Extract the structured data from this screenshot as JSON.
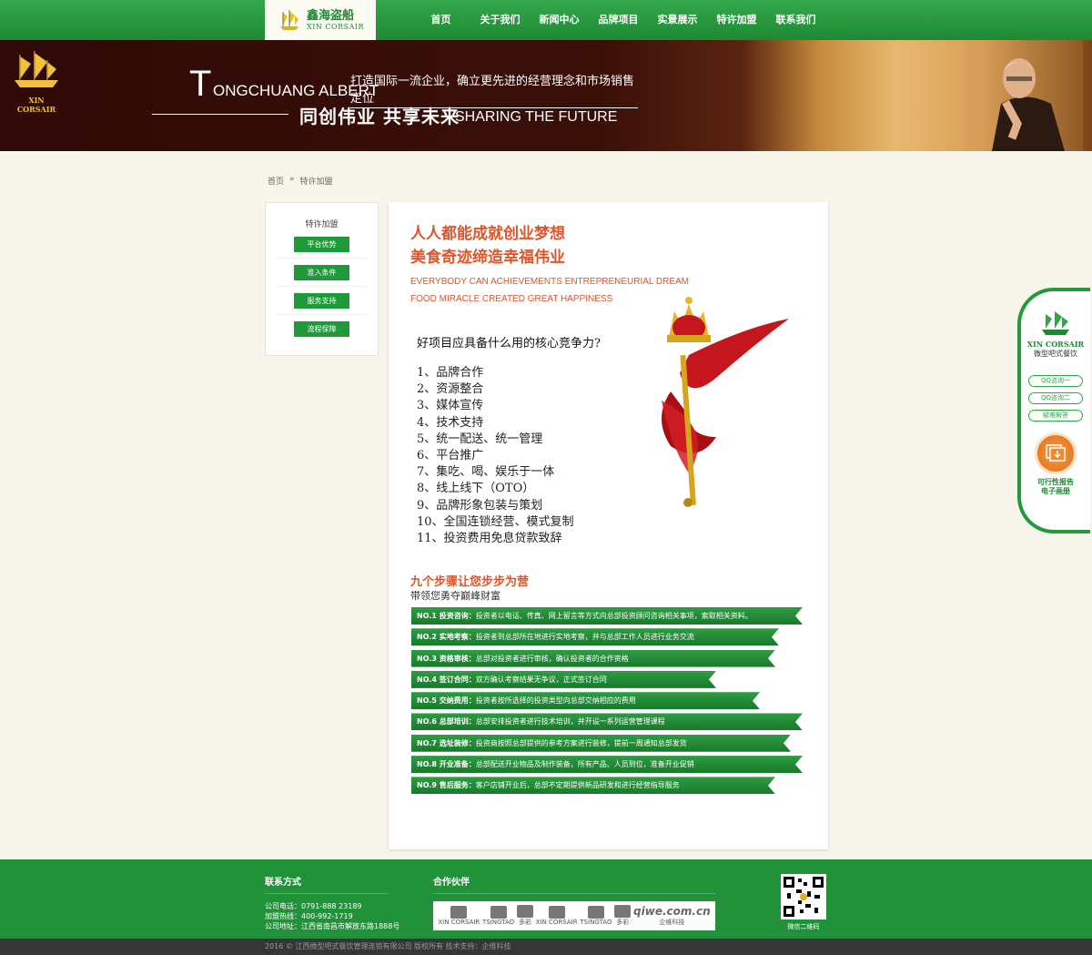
{
  "header": {
    "logo_cn": "鑫海盗船",
    "logo_en": "XIN CORSAIR",
    "nav": [
      "首页",
      "关于我们",
      "新闻中心",
      "品牌项目",
      "实景展示",
      "特许加盟",
      "联系我们"
    ]
  },
  "banner": {
    "logo_text": "XIN CORSAIR",
    "big_letter": "T",
    "en_name": "ONGCHUANG ALBERT",
    "slogan_cn1": "打造国际一流企业，确立更先进的经营理念和市场销售定位",
    "slogan_cn2": "同创伟业 共享未来",
    "slogan_en2": "SHARING THE FUTURE"
  },
  "breadcrumb": {
    "home": "首页",
    "sep": "»",
    "current": "特许加盟"
  },
  "sidebar": {
    "title": "特许加盟",
    "items": [
      "平台优势",
      "准入条件",
      "服务支持",
      "流程保障"
    ]
  },
  "content": {
    "headline1": "人人都能成就创业梦想",
    "headline2": "美食奇迹缔造幸福伟业",
    "en1": "EVERYBODY CAN ACHIEVEMENTS ENTREPRENEURIAL DREAM",
    "en2": "FOOD MIRACLE CREATED GREAT HAPPINESS",
    "question": "好项目应具备什么用的核心竞争力?",
    "list": [
      "1、品牌合作",
      "2、资源整合",
      "3、媒体宣传",
      "4、技术支持",
      "5、统一配送、统一管理",
      "6、平台推广",
      "7、集吃、喝、娱乐于一体",
      "8、线上线下（OTO）",
      "9、品牌形象包装与策划",
      "10、全国连锁经营、模式复制",
      "11、投资费用免息贷款致辞"
    ],
    "steps_title": "九个步骤让您步步为营",
    "steps_sub": "带领您勇夺巅峰财富",
    "steps": [
      {
        "no": "NO.1 投资咨询：",
        "text": "投资者以电话、传真、网上留言等方式向总部投资顾问咨询相关事项，索取相关资料。",
        "fill": 1.0
      },
      {
        "no": "NO.2 实地考察：",
        "text": "投资者到总部所在地进行实地考察，并与总部工作人员进行业务交流",
        "fill": 0.94
      },
      {
        "no": "NO.3 资格审核：",
        "text": "总部对投资者进行审核，确认投资者的合作资格",
        "fill": 0.93
      },
      {
        "no": "NO.4 签订合同：",
        "text": "双方确认考察结果无争议，正式签订合同",
        "fill": 0.78
      },
      {
        "no": "NO.5 交纳费用：",
        "text": "投资者按所选择的投资类型向总部交纳相应的费用",
        "fill": 0.89
      },
      {
        "no": "NO.6 总部培训：",
        "text": "总部安排投资者进行技术培训，并开设一系列运营管理课程",
        "fill": 1.0
      },
      {
        "no": "NO.7 选址装修：",
        "text": "投资商按照总部提供的参考方案进行装修，提前一周通知总部发货",
        "fill": 0.97
      },
      {
        "no": "NO.8 开业准备：",
        "text": "总部配送开业物品及制作装备，所有产品、人员到位，准备开业促销",
        "fill": 1.0
      },
      {
        "no": "NO.9 售后服务：",
        "text": "客户店铺开业后，总部不定期提供新品研发和进行经营指导服务",
        "fill": 0.93
      }
    ]
  },
  "float": {
    "brand_en": "XIN CORSAIR",
    "brand_cn": "微型吧式餐饮",
    "buttons": [
      "QQ咨询一",
      "QQ咨询二",
      "疑难解答"
    ],
    "report_line1": "可行性报告",
    "report_line2": "电子画册"
  },
  "footer": {
    "contact_title": "联系方式",
    "phone": "公司电话：0791-888 23189",
    "hotline": "加盟热线：400-992-1719",
    "address": "公司地址：江西省南昌市解放东路1888号",
    "partners_title": "合作伙伴",
    "partners": [
      "XIN CORSAIR",
      "TSINGTAO",
      "多彩",
      "XIN CORSAIR",
      "TSINGTAO",
      "多彩"
    ],
    "partner_last": "qiwe.com.cn",
    "partner_last_sub": "企维科技",
    "qr_caption": "微信二维码",
    "copyright": "2016 © 江西微型吧式餐饮管理连锁有限公司 版权所有 技术支持：企维科技"
  },
  "colors": {
    "primary_green": "#1e9a3a",
    "accent_orange": "#e0542a",
    "banner_dark": "#3a0f08"
  }
}
